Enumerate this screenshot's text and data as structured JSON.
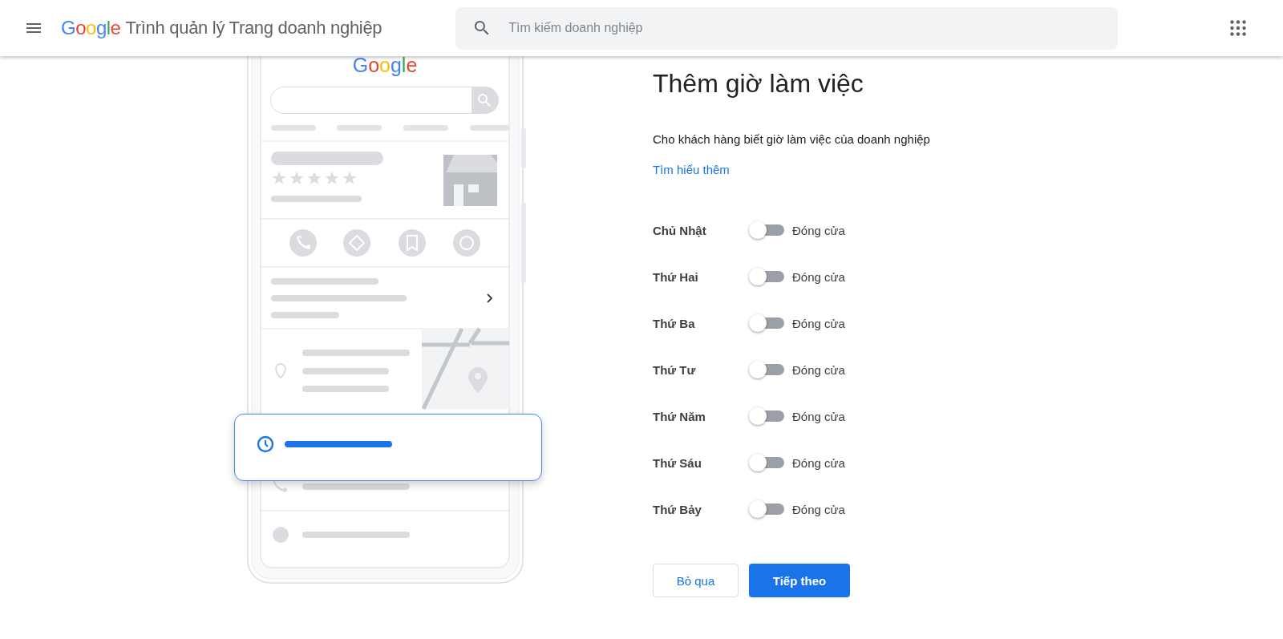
{
  "header": {
    "logo": "Google",
    "title": "Trình quản lý Trang doanh nghiệp",
    "search": {
      "placeholder": "Tìm kiếm doanh nghiệp"
    }
  },
  "illustration": {
    "logo": "Google"
  },
  "page": {
    "title": "Thêm giờ làm việc",
    "description": "Cho khách hàng biết giờ làm việc của doanh nghiệp",
    "link": "Tìm hiểu thêm"
  },
  "days": [
    {
      "name": "Chủ Nhật",
      "on": false,
      "status": "Đóng cửa"
    },
    {
      "name": "Thứ Hai",
      "on": false,
      "status": "Đóng cửa"
    },
    {
      "name": "Thứ Ba",
      "on": false,
      "status": "Đóng cửa"
    },
    {
      "name": "Thứ Tư",
      "on": false,
      "status": "Đóng cửa"
    },
    {
      "name": "Thứ Năm",
      "on": false,
      "status": "Đóng cửa"
    },
    {
      "name": "Thứ Sáu",
      "on": false,
      "status": "Đóng cửa"
    },
    {
      "name": "Thứ Bảy",
      "on": false,
      "status": "Đóng cửa"
    }
  ],
  "buttons": [
    {
      "label": "Bỏ qua",
      "kind": "secondary"
    },
    {
      "label": "Tiếp theo",
      "kind": "primary"
    }
  ]
}
